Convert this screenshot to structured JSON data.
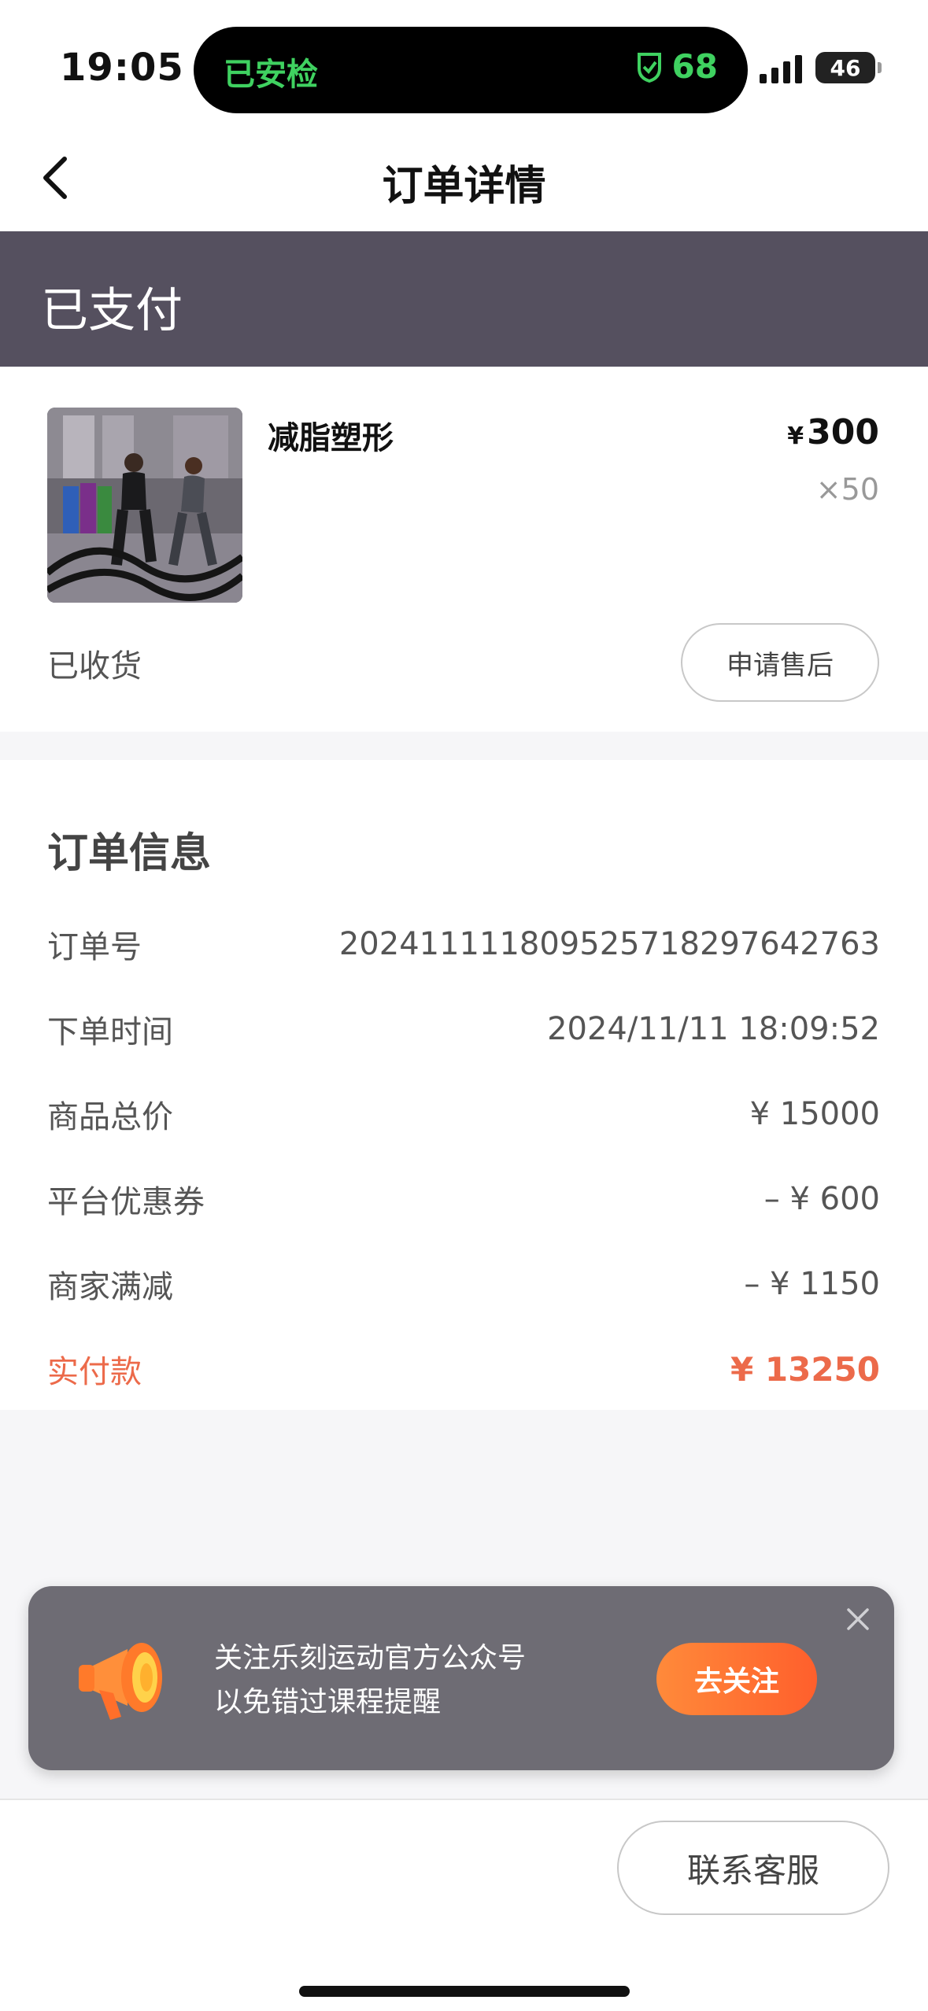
{
  "status_bar": {
    "time": "19:05",
    "island_left": "已安检",
    "island_right_value": "68",
    "island_right_icon": "shield-check-icon",
    "battery": "46",
    "accent_green": "#3fd160"
  },
  "nav": {
    "title": "订单详情",
    "back_icon": "chevron-left-icon"
  },
  "order_status": {
    "text": "已支付",
    "background": "#55505f"
  },
  "product": {
    "name": "减脂塑形",
    "currency": "¥",
    "price": "300",
    "quantity": "×50",
    "delivery_status": "已收货",
    "after_sale_label": "申请售后"
  },
  "order_info": {
    "title": "订单信息",
    "rows": [
      {
        "label": "订单号",
        "value": "20241111180952571829764​2763"
      },
      {
        "label": "下单时间",
        "value": "2024/11/11 18:09:52"
      },
      {
        "label": "商品总价",
        "value": "¥ 15000"
      },
      {
        "label": "平台优惠券",
        "value": "– ¥ 600"
      },
      {
        "label": "商家满减",
        "value": "– ¥ 1150"
      },
      {
        "label": "实付款",
        "value": "¥ 13250"
      }
    ],
    "accent_red": "#ec6a4a"
  },
  "promo": {
    "line1": "关注乐刻运动官方公众号",
    "line2": "以免错过课程提醒",
    "button": "去关注",
    "icon": "megaphone-icon",
    "close_icon": "close-icon"
  },
  "bottom": {
    "support_label": "联系客服"
  }
}
